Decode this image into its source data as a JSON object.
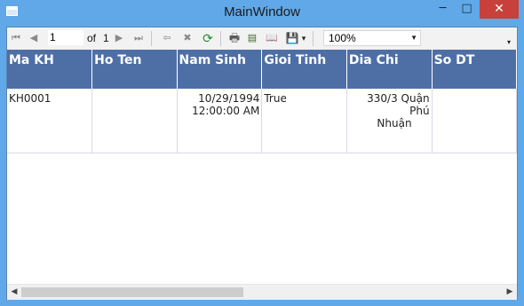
{
  "window": {
    "title": "MainWindow",
    "minimize_glyph": "─",
    "maximize_glyph": "□",
    "close_glyph": "✕"
  },
  "toolbar": {
    "first_glyph": "⏮",
    "prev_glyph": "◀",
    "next_glyph": "▶",
    "last_glyph": "⏭",
    "page_value": "1",
    "of_label": "of",
    "total_pages": "1",
    "back_glyph": "⇦",
    "stop_glyph": "✖",
    "refresh_glyph": "⟳",
    "print_glyph": "🖶",
    "layout_glyph": "▤",
    "pagesetup_glyph": "📖",
    "export_glyph": "💾",
    "export_arrow": "▾",
    "zoom_value": "100%",
    "zoom_arrow": "▼",
    "overflow_glyph": "▾"
  },
  "report": {
    "columns": [
      "Ma KH",
      "Ho Ten",
      "Nam Sinh",
      "Gioi Tinh",
      "Dia Chi",
      "So DT"
    ],
    "rows": [
      {
        "ma_kh": "KH0001",
        "ho_ten": "",
        "nam_sinh_date": "10/29/1994",
        "nam_sinh_time": "12:00:00 AM",
        "gioi_tinh": "True",
        "dia_chi_line1": "330/3 Quận Phú",
        "dia_chi_line2": "Nhuận",
        "so_dt": ""
      }
    ]
  },
  "scrollbar": {
    "left_glyph": "◀",
    "right_glyph": "▶"
  },
  "colors": {
    "titlebar": "#60a8e8",
    "header_bg": "#4e6fa6",
    "close_bg": "#c7413a"
  }
}
